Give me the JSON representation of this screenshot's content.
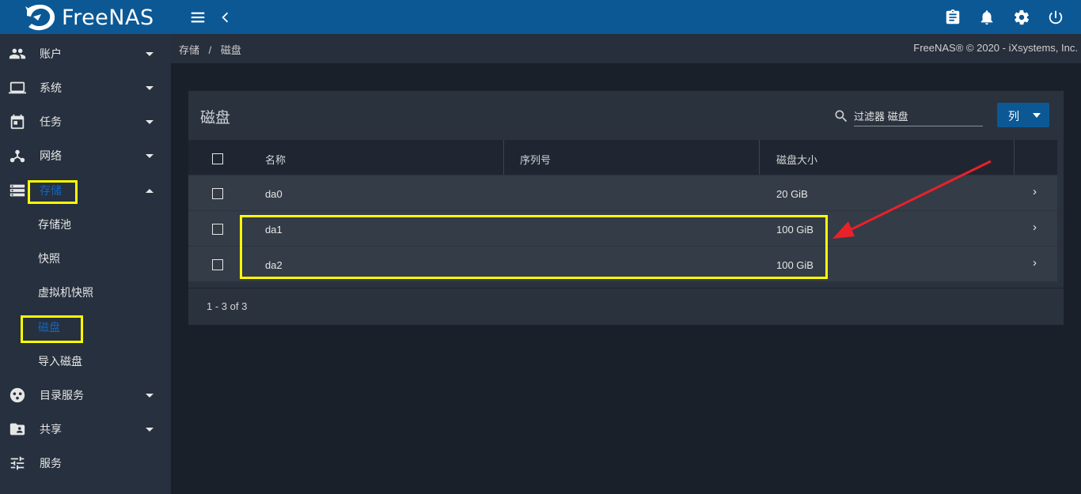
{
  "topbar": {
    "brand": "FreeNAS",
    "icons": [
      "menu-icon",
      "chevron-left-icon",
      "clipboard-icon",
      "bell-icon",
      "gear-icon",
      "power-icon"
    ]
  },
  "sidebar": {
    "items": [
      {
        "label": "账户",
        "icon": "people-icon"
      },
      {
        "label": "系统",
        "icon": "laptop-icon"
      },
      {
        "label": "任务",
        "icon": "calendar-icon"
      },
      {
        "label": "网络",
        "icon": "network-icon"
      },
      {
        "label": "存储",
        "icon": "storage-icon"
      },
      {
        "label": "目录服务",
        "icon": "directory-icon"
      },
      {
        "label": "共享",
        "icon": "folder-share-icon"
      },
      {
        "label": "服务",
        "icon": "sliders-icon"
      }
    ],
    "storage_sub": [
      "存储池",
      "快照",
      "虚拟机快照",
      "磁盘",
      "导入磁盘"
    ]
  },
  "breadcrumb": {
    "parent": "存储",
    "separator": "/",
    "current": "磁盘"
  },
  "copyright": "FreeNAS® © 2020 - iXsystems, Inc.",
  "card": {
    "title": "磁盘",
    "filter_placeholder": "过滤器 磁盘",
    "columns_button": "列"
  },
  "table": {
    "headers": [
      "名称",
      "序列号",
      "磁盘大小"
    ],
    "rows": [
      {
        "name": "da0",
        "serial": "",
        "size": "20 GiB"
      },
      {
        "name": "da1",
        "serial": "",
        "size": "100 GiB"
      },
      {
        "name": "da2",
        "serial": "",
        "size": "100 GiB"
      }
    ],
    "pagination": "1 - 3 of 3"
  },
  "colors": {
    "topbar": "#0b5895",
    "sidebar": "#26303e",
    "background": "#1a2029",
    "highlight": "#ffff00",
    "arrow": "#e8212a",
    "active": "#1565c0"
  }
}
